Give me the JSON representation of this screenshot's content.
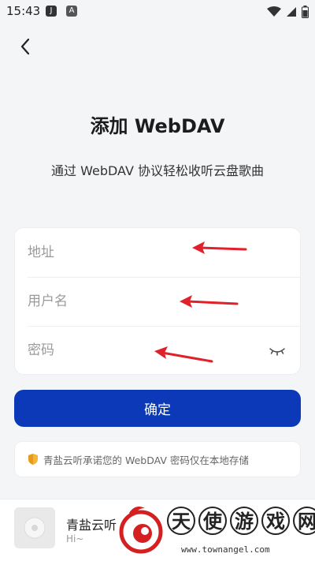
{
  "status_bar": {
    "time": "15:43",
    "app_icons": [
      "J",
      "A"
    ]
  },
  "header": {
    "title": "添加 WebDAV",
    "subtitle": "通过 WebDAV 协议轻松收听云盘歌曲"
  },
  "form": {
    "address_placeholder": "地址",
    "username_placeholder": "用户名",
    "password_placeholder": "密码",
    "address_value": "",
    "username_value": "",
    "password_value": ""
  },
  "confirm_label": "确定",
  "notice": {
    "text": "青盐云听承诺您的 WebDAV 密码仅在本地存储",
    "icon": "shield-icon"
  },
  "player": {
    "title": "青盐云听",
    "subtitle": "Hi~"
  },
  "watermark": {
    "chars": [
      "天",
      "使",
      "游",
      "戏",
      "网"
    ],
    "url": "www.townangel.com"
  },
  "colors": {
    "primary": "#0b39b8",
    "background": "#f4f5f7",
    "annotation_arrow": "#e0202a"
  }
}
